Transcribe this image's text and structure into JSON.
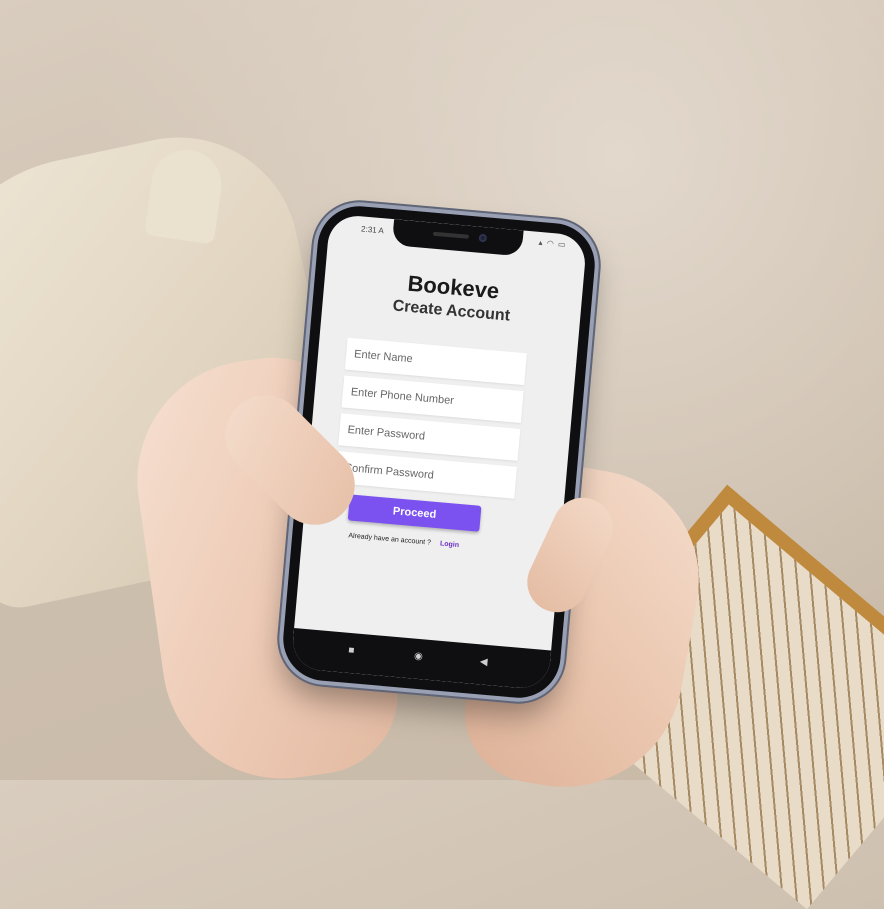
{
  "status": {
    "time": "2:31 A",
    "icons": "▴ ◠ ▭"
  },
  "app": {
    "title": "Bookeve",
    "subtitle": "Create Account"
  },
  "form": {
    "name_placeholder": "Enter Name",
    "phone_placeholder": "Enter Phone Number",
    "password_placeholder": "Enter Password",
    "confirm_placeholder": "Confirm Password",
    "name_value": "",
    "phone_value": "",
    "password_value": "",
    "confirm_value": ""
  },
  "actions": {
    "proceed_label": "Proceed",
    "account_prompt": "Already have an account ?",
    "login_label": "Login"
  },
  "navbar": {
    "recents_icon": "■",
    "home_icon": "◉",
    "back_icon": "◀"
  },
  "colors": {
    "accent": "#7b52f0",
    "link": "#6a2fc4",
    "screen_bg": "#efefef"
  }
}
